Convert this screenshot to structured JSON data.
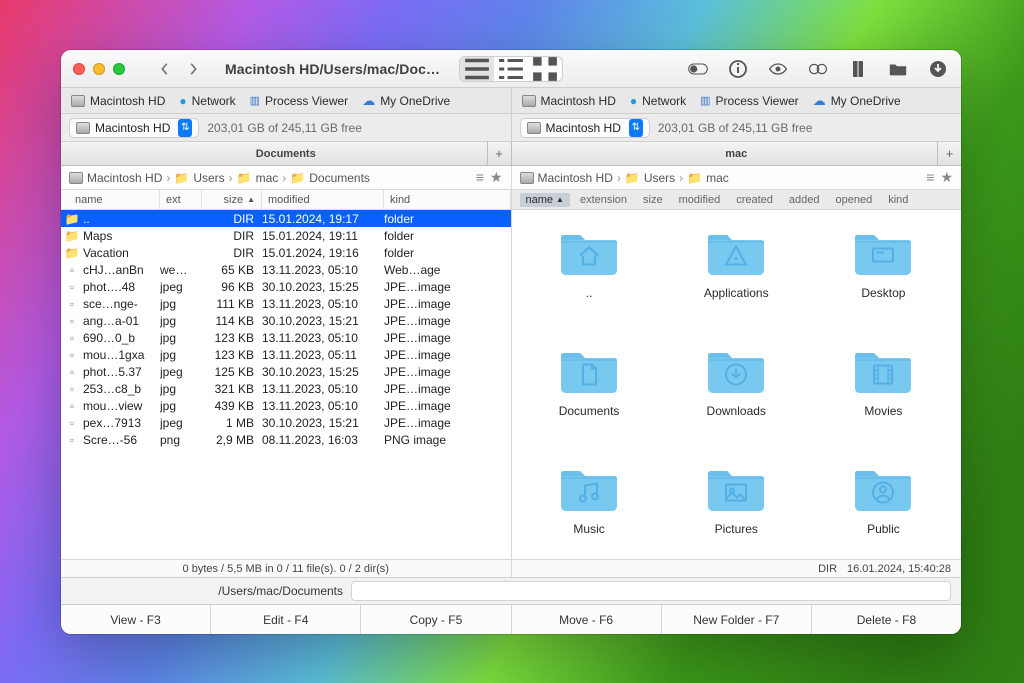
{
  "window": {
    "title": "Macintosh HD/Users/mac/Docu...",
    "toolbar_segments": [
      "list",
      "columns",
      "grid"
    ]
  },
  "favorites": {
    "left": [
      {
        "label": "Macintosh HD",
        "icon": "drive"
      },
      {
        "label": "Network",
        "icon": "globe"
      },
      {
        "label": "Process Viewer",
        "icon": "monitor"
      },
      {
        "label": "My OneDrive",
        "icon": "cloud"
      }
    ],
    "right": [
      {
        "label": "Macintosh HD",
        "icon": "drive"
      },
      {
        "label": "Network",
        "icon": "globe"
      },
      {
        "label": "Process Viewer",
        "icon": "monitor"
      },
      {
        "label": "My OneDrive",
        "icon": "cloud"
      }
    ]
  },
  "drive_bar": {
    "left": {
      "drive": "Macintosh HD",
      "space": "203,01 GB of 245,11 GB free"
    },
    "right": {
      "drive": "Macintosh HD",
      "space": "203,01 GB of 245,11 GB free"
    }
  },
  "tabs": {
    "left": "Documents",
    "right": "mac"
  },
  "breadcrumbs": {
    "left": [
      "Macintosh HD",
      "Users",
      "mac",
      "Documents"
    ],
    "right": [
      "Macintosh HD",
      "Users",
      "mac"
    ]
  },
  "list_columns": {
    "name": "name",
    "ext": "ext",
    "size": "size",
    "modified": "modified",
    "kind": "kind"
  },
  "list_rows": [
    {
      "sel": true,
      "icon": "folder",
      "name": "..",
      "ext": "",
      "size": "DIR",
      "mod": "15.01.2024, 19:17",
      "kind": "folder"
    },
    {
      "icon": "folder",
      "name": "Maps",
      "ext": "",
      "size": "DIR",
      "mod": "15.01.2024, 19:11",
      "kind": "folder"
    },
    {
      "icon": "folder",
      "name": "Vacation",
      "ext": "",
      "size": "DIR",
      "mod": "15.01.2024, 19:16",
      "kind": "folder"
    },
    {
      "icon": "file",
      "name": "cHJ…anBn",
      "ext": "we…",
      "size": "65 KB",
      "mod": "13.11.2023, 05:10",
      "kind": "Web…age"
    },
    {
      "icon": "file",
      "name": "phot….48",
      "ext": "jpeg",
      "size": "96 KB",
      "mod": "30.10.2023, 15:25",
      "kind": "JPE…image"
    },
    {
      "icon": "file",
      "name": "sce…nge-",
      "ext": "jpg",
      "size": "111 KB",
      "mod": "13.11.2023, 05:10",
      "kind": "JPE…image"
    },
    {
      "icon": "file",
      "name": "ang…a-01",
      "ext": "jpg",
      "size": "114 KB",
      "mod": "30.10.2023, 15:21",
      "kind": "JPE…image"
    },
    {
      "icon": "file",
      "name": "690…0_b",
      "ext": "jpg",
      "size": "123 KB",
      "mod": "13.11.2023, 05:10",
      "kind": "JPE…image"
    },
    {
      "icon": "file",
      "name": "mou…1gxa",
      "ext": "jpg",
      "size": "123 KB",
      "mod": "13.11.2023, 05:11",
      "kind": "JPE…image"
    },
    {
      "icon": "file",
      "name": "phot…5.37",
      "ext": "jpeg",
      "size": "125 KB",
      "mod": "30.10.2023, 15:25",
      "kind": "JPE…image"
    },
    {
      "icon": "file",
      "name": "253…c8_b",
      "ext": "jpg",
      "size": "321 KB",
      "mod": "13.11.2023, 05:10",
      "kind": "JPE…image"
    },
    {
      "icon": "file",
      "name": "mou…view",
      "ext": "jpg",
      "size": "439 KB",
      "mod": "13.11.2023, 05:10",
      "kind": "JPE…image"
    },
    {
      "icon": "file",
      "name": "pex…7913",
      "ext": "jpeg",
      "size": "1 MB",
      "mod": "30.10.2023, 15:21",
      "kind": "JPE…image"
    },
    {
      "icon": "file",
      "name": "Scre…-56",
      "ext": "png",
      "size": "2,9 MB",
      "mod": "08.11.2023, 16:03",
      "kind": "PNG image"
    }
  ],
  "list_status": "0 bytes / 5,5 MB in 0 / 11 file(s). 0 / 2 dir(s)",
  "icon_columns": [
    "name",
    "extension",
    "size",
    "modified",
    "created",
    "added",
    "opened",
    "kind"
  ],
  "icon_items": [
    {
      "label": "..",
      "kind": "home"
    },
    {
      "label": "Applications",
      "kind": "apps"
    },
    {
      "label": "Desktop",
      "kind": "desktop"
    },
    {
      "label": "Documents",
      "kind": "docs"
    },
    {
      "label": "Downloads",
      "kind": "downloads"
    },
    {
      "label": "Movies",
      "kind": "movies"
    },
    {
      "label": "Music",
      "kind": "music"
    },
    {
      "label": "Pictures",
      "kind": "pictures"
    },
    {
      "label": "Public",
      "kind": "public"
    }
  ],
  "icon_status": {
    "kind": "DIR",
    "date": "16.01.2024, 15:40:28"
  },
  "path_field": "/Users/mac/Documents",
  "commands": [
    "View - F3",
    "Edit - F4",
    "Copy - F5",
    "Move - F6",
    "New Folder - F7",
    "Delete - F8"
  ]
}
